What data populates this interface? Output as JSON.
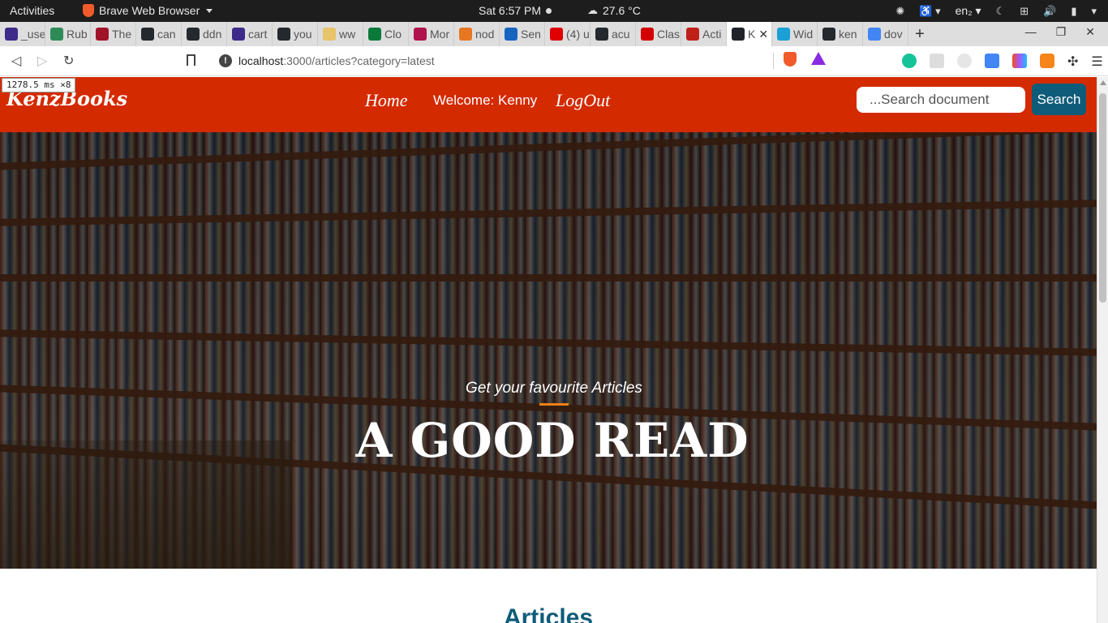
{
  "system_bar": {
    "activities": "Activities",
    "app_name": "Brave Web Browser",
    "clock": "Sat  6:57 PM",
    "weather": "27.6 °C",
    "language": "en₂"
  },
  "tabs": [
    {
      "label": "_use",
      "color": "#3d2b8a"
    },
    {
      "label": "Rub",
      "color": "#2e8b57"
    },
    {
      "label": "The",
      "color": "#a0142a"
    },
    {
      "label": "can",
      "color": "#24292e"
    },
    {
      "label": "ddn",
      "color": "#24292e"
    },
    {
      "label": "cart",
      "color": "#3d2b8a"
    },
    {
      "label": "you",
      "color": "#24292e"
    },
    {
      "label": "ww",
      "color": "#e8c46a"
    },
    {
      "label": "Clo",
      "color": "#0a7a3a"
    },
    {
      "label": "Mor",
      "color": "#b0124c"
    },
    {
      "label": "nod",
      "color": "#e87722"
    },
    {
      "label": "Sen",
      "color": "#1565c0"
    },
    {
      "label": "(4) u",
      "color": "#e00000"
    },
    {
      "label": "acu",
      "color": "#24292e"
    },
    {
      "label": "Clas",
      "color": "#d40000"
    },
    {
      "label": "Acti",
      "color": "#c0201a"
    },
    {
      "label": "K",
      "color": "#20232a",
      "active": true
    },
    {
      "label": "Wid",
      "color": "#1a9fd6"
    },
    {
      "label": "ken",
      "color": "#24292e"
    },
    {
      "label": "dov",
      "color": "#4285f4"
    }
  ],
  "address_bar": {
    "host": "localhost",
    "path": ":3000/articles?category=latest"
  },
  "devtools_tip": "1278.5 ms ×8",
  "site": {
    "brand": "KenzBooks",
    "nav_home": "Home",
    "welcome": "Welcome: Kenny",
    "nav_logout": "LogOut",
    "search_placeholder": "...Search document",
    "search_button": "Search"
  },
  "hero": {
    "subtitle": "Get your favourite Articles",
    "title": "A GOOD READ"
  },
  "articles_heading": "Articles",
  "colors": {
    "navbar": "#d42a00",
    "search_button": "#0e5c7a",
    "accent_rule": "#f08018",
    "heading": "#0e5c7a"
  }
}
